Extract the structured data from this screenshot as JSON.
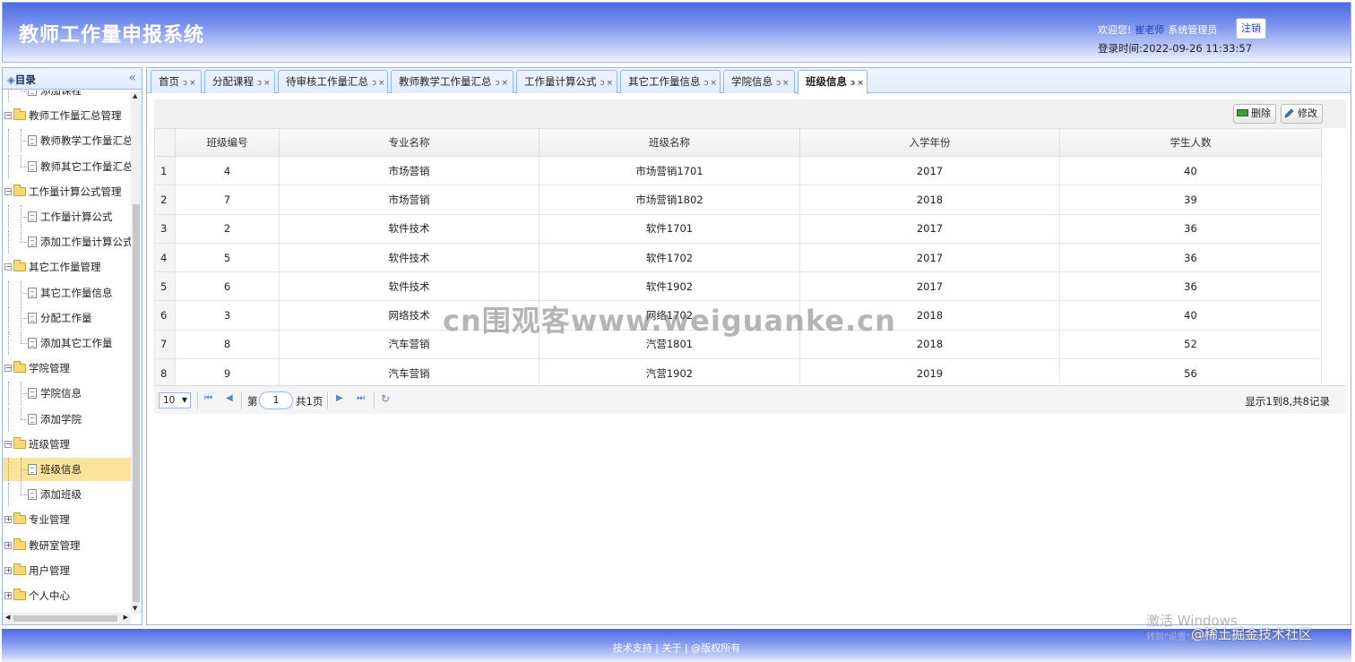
{
  "header": {
    "title": "教师工作量申报系统",
    "welcome_prefix": "欢迎您!",
    "user_name": "崔老师",
    "role": "系统管理员",
    "logout_label": "注销",
    "login_time": "登录时间:2022-09-26 11:33:57"
  },
  "sidebar": {
    "title": "目录",
    "collapse_icon": "«",
    "items": [
      {
        "label": "添加课程",
        "type": "leaf",
        "last": true
      },
      {
        "label": "教师工作量汇总管理",
        "type": "folder"
      },
      {
        "label": "教师教学工作量汇总",
        "type": "leaf"
      },
      {
        "label": "教师其它工作量汇总",
        "type": "leaf",
        "last": true
      },
      {
        "label": "工作量计算公式管理",
        "type": "folder"
      },
      {
        "label": "工作量计算公式",
        "type": "leaf"
      },
      {
        "label": "添加工作量计算公式",
        "type": "leaf",
        "last": true
      },
      {
        "label": "其它工作量管理",
        "type": "folder"
      },
      {
        "label": "其它工作量信息",
        "type": "leaf"
      },
      {
        "label": "分配工作量",
        "type": "leaf"
      },
      {
        "label": "添加其它工作量",
        "type": "leaf",
        "last": true
      },
      {
        "label": "学院管理",
        "type": "folder"
      },
      {
        "label": "学院信息",
        "type": "leaf"
      },
      {
        "label": "添加学院",
        "type": "leaf",
        "last": true
      },
      {
        "label": "班级管理",
        "type": "folder"
      },
      {
        "label": "班级信息",
        "type": "leaf",
        "selected": true
      },
      {
        "label": "添加班级",
        "type": "leaf",
        "last": true
      },
      {
        "label": "专业管理",
        "type": "folder-collapsed"
      },
      {
        "label": "教研室管理",
        "type": "folder-collapsed"
      },
      {
        "label": "用户管理",
        "type": "folder-collapsed"
      },
      {
        "label": "个人中心",
        "type": "folder-collapsed"
      }
    ]
  },
  "tabs": [
    {
      "label": "首页"
    },
    {
      "label": "分配课程"
    },
    {
      "label": "待审核工作量汇总"
    },
    {
      "label": "教师教学工作量汇总"
    },
    {
      "label": "工作量计算公式"
    },
    {
      "label": "其它工作量信息"
    },
    {
      "label": "学院信息"
    },
    {
      "label": "班级信息",
      "active": true
    }
  ],
  "tab_icons": {
    "refresh": "ↄ",
    "close": "×"
  },
  "toolbar": {
    "delete_label": "删除",
    "edit_label": "修改"
  },
  "table": {
    "columns": [
      "班级编号",
      "专业名称",
      "班级名称",
      "入学年份",
      "学生人数"
    ],
    "rows": [
      [
        "4",
        "市场营销",
        "市场营销1701",
        "2017",
        "40"
      ],
      [
        "7",
        "市场营销",
        "市场营销1802",
        "2018",
        "39"
      ],
      [
        "2",
        "软件技术",
        "软件1701",
        "2017",
        "36"
      ],
      [
        "5",
        "软件技术",
        "软件1702",
        "2017",
        "36"
      ],
      [
        "6",
        "软件技术",
        "软件1902",
        "2017",
        "36"
      ],
      [
        "3",
        "网络技术",
        "网络1702",
        "2018",
        "40"
      ],
      [
        "8",
        "汽车营销",
        "汽营1801",
        "2018",
        "52"
      ],
      [
        "9",
        "汽车营销",
        "汽营1902",
        "2019",
        "56"
      ]
    ]
  },
  "pager": {
    "page_size": "10",
    "page_prefix": "第",
    "page_value": "1",
    "page_suffix": "共1页",
    "info": "显示1到8,共8记录"
  },
  "footer": {
    "text": "技术支持 | 关于 | @版权所有"
  },
  "overlays": {
    "watermark": "cn围观客www.weiguanke.cn",
    "windows_activate": "激活 Windows",
    "windows_activate_sub": "转到\"设置\"以激活 Windows。",
    "juejin": "@稀土掘金技术社区"
  },
  "colors": {
    "header_blue": "#4d6ae0",
    "border_blue": "#95b8e7",
    "selected_row": "#fbe39b"
  }
}
